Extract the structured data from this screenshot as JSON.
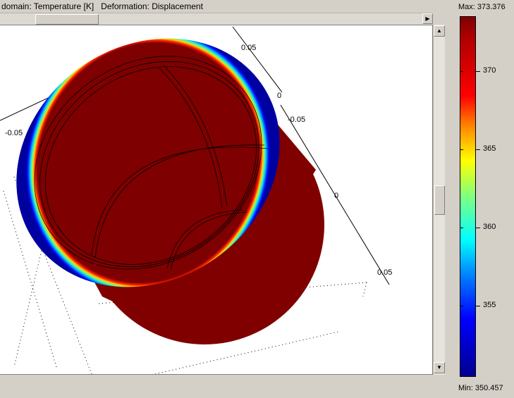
{
  "header": {
    "text": "domain: Temperature [K]   Deformation: Displacement"
  },
  "colorbar": {
    "max_label": "Max: 373.376",
    "min_label": "Min: 350.457",
    "ticks": [
      "370",
      "365",
      "360",
      "355"
    ]
  },
  "axes": {
    "labels": [
      "0.05",
      "0",
      "-0.05",
      "-0.05",
      "0",
      "0.05"
    ]
  }
}
